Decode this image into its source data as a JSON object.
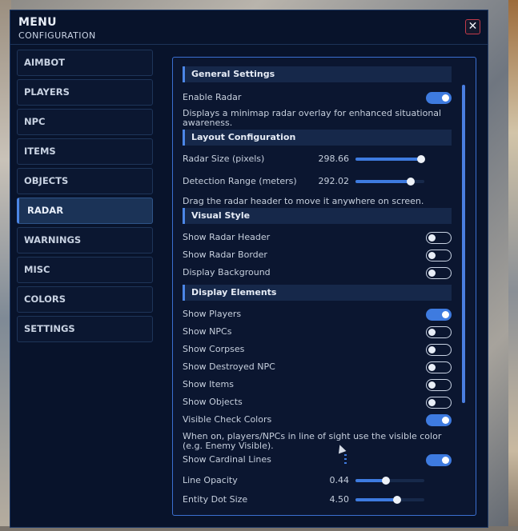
{
  "window": {
    "title": "MENU",
    "subtitle": "CONFIGURATION",
    "close_label": "✕"
  },
  "nav": {
    "items": [
      {
        "label": "AIMBOT"
      },
      {
        "label": "PLAYERS"
      },
      {
        "label": "NPC"
      },
      {
        "label": "ITEMS"
      },
      {
        "label": "OBJECTS"
      },
      {
        "label": "RADAR",
        "active": true
      },
      {
        "label": "WARNINGS"
      },
      {
        "label": "MISC"
      },
      {
        "label": "COLORS"
      },
      {
        "label": "SETTINGS"
      }
    ]
  },
  "radar": {
    "general": {
      "title": "General Settings",
      "enable_radar": {
        "label": "Enable Radar",
        "on": true
      },
      "enable_desc": "Displays a minimap radar overlay for enhanced situational awareness."
    },
    "layout": {
      "title": "Layout Configuration",
      "radar_size": {
        "label": "Radar Size (pixels)",
        "value": "298.66",
        "fraction": 0.95
      },
      "detection_range": {
        "label": "Detection Range (meters)",
        "value": "292.02",
        "fraction": 0.8
      },
      "drag_hint": "Drag the radar header to move it anywhere on screen."
    },
    "visual": {
      "title": "Visual Style",
      "show_header": {
        "label": "Show Radar Header",
        "on": false
      },
      "show_border": {
        "label": "Show Radar Border",
        "on": false
      },
      "display_background": {
        "label": "Display Background",
        "on": false
      }
    },
    "display": {
      "title": "Display Elements",
      "show_players": {
        "label": "Show Players",
        "on": true
      },
      "show_npcs": {
        "label": "Show NPCs",
        "on": false
      },
      "show_corpses": {
        "label": "Show Corpses",
        "on": false
      },
      "show_destroyed_npc": {
        "label": "Show Destroyed NPC",
        "on": false
      },
      "show_items": {
        "label": "Show Items",
        "on": false
      },
      "show_objects": {
        "label": "Show Objects",
        "on": false
      },
      "visible_check_colors": {
        "label": "Visible Check Colors",
        "on": true
      },
      "visible_desc": "When on, players/NPCs in line of sight use the visible color (e.g. Enemy Visible).",
      "show_cardinal_lines": {
        "label": "Show Cardinal Lines",
        "on": true
      },
      "line_opacity": {
        "label": "Line Opacity",
        "value": "0.44",
        "fraction": 0.44
      },
      "entity_dot_size": {
        "label": "Entity Dot Size",
        "value": "4.50",
        "fraction": 0.6
      }
    }
  },
  "colors": {
    "accent": "#3e7be0",
    "panel_border": "#3b6fd0",
    "window_bg": "#08132b",
    "close_border": "#c23a4a"
  },
  "icons": {
    "close": "close-icon",
    "cursor": "mouse-cursor-icon"
  }
}
